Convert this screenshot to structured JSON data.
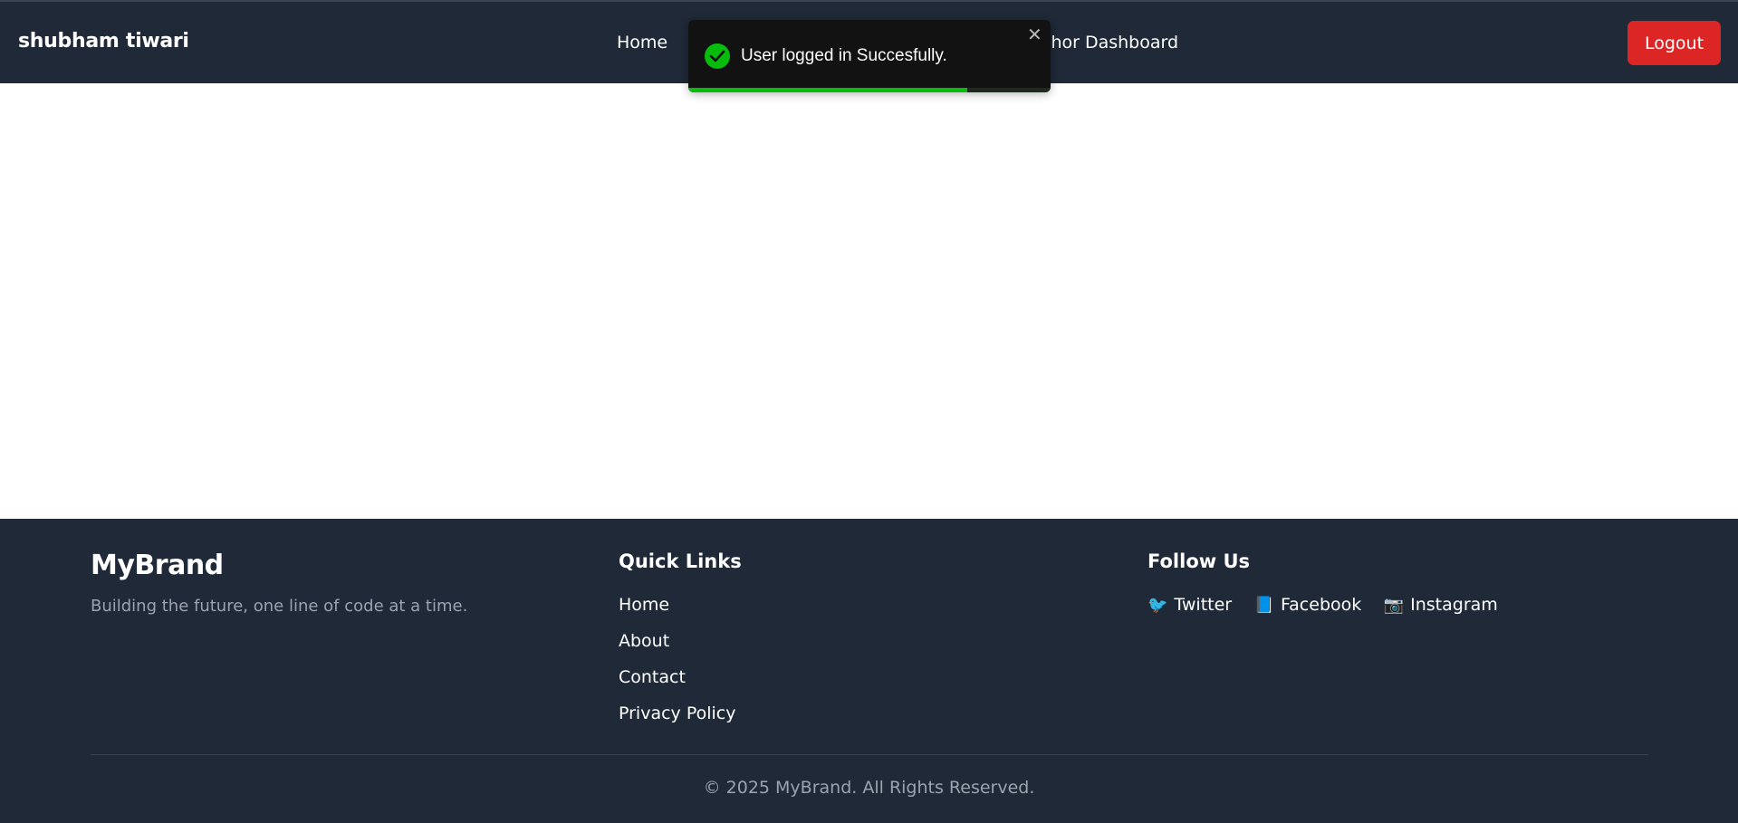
{
  "navbar": {
    "brand": "shubham tiwari",
    "links": [
      {
        "label": "Home"
      },
      {
        "label": "Author Dashboard",
        "visible_text": "thor Dashboard"
      }
    ],
    "logout_label": "Logout"
  },
  "toast": {
    "message": "User logged in Succesfully.",
    "close_glyph": "✕",
    "icon": "check-circle-icon",
    "progress_fraction": 0.77,
    "accent_color": "#07bc0c"
  },
  "footer": {
    "brand": {
      "title": "MyBrand",
      "tagline": "Building the future, one line of code at a time."
    },
    "quick_links": {
      "heading": "Quick Links",
      "items": [
        "Home",
        "About",
        "Contact",
        "Privacy Policy"
      ]
    },
    "follow": {
      "heading": "Follow Us",
      "items": [
        {
          "icon": "🐦",
          "label": "Twitter"
        },
        {
          "icon": "📘",
          "label": "Facebook"
        },
        {
          "icon": "📷",
          "label": "Instagram"
        }
      ]
    },
    "copyright": "© 2025 MyBrand. All Rights Reserved."
  },
  "colors": {
    "navbar_bg": "#1f2937",
    "logout_bg": "#dc2626",
    "muted_text": "#9ca3af"
  }
}
